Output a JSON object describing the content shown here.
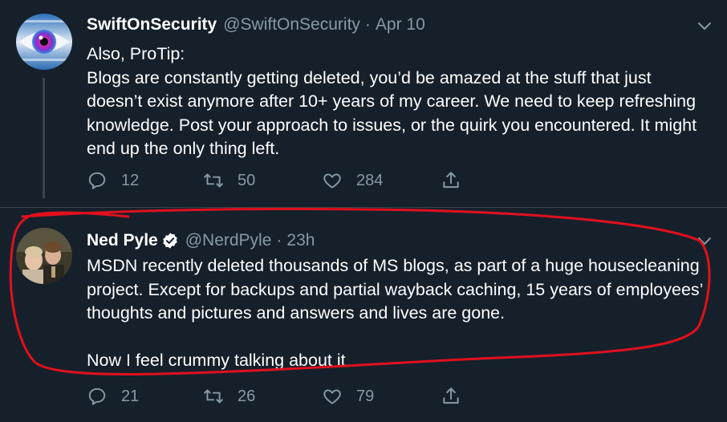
{
  "tweets": [
    {
      "name": "SwiftOnSecurity",
      "handle": "@SwiftOnSecurity",
      "dot": "·",
      "time": "Apr 10",
      "body": "Also, ProTip:\nBlogs are constantly getting deleted, you’d be amazed at the stuff that just doesn’t exist anymore after 10+ years of my career. We need to keep refreshing knowledge. Post your approach to issues, or the quirk you encountered. It might end up the only thing left.",
      "replies": "12",
      "retweets": "50",
      "likes": "284"
    },
    {
      "name": "Ned Pyle",
      "handle": "@NerdPyle",
      "dot": "·",
      "time": "23h",
      "body": "MSDN recently deleted thousands of MS blogs, as part of a huge housecleaning project. Except for backups and partial wayback caching, 15 years of employees’ thoughts and pictures and answers and lives are gone.\n\nNow I feel crummy talking about it",
      "replies": "21",
      "retweets": "26",
      "likes": "79"
    }
  ],
  "colors": {
    "background": "#15202b",
    "muted": "#8899a6",
    "verified": "#ffffff",
    "annotation": "#e0101c"
  }
}
